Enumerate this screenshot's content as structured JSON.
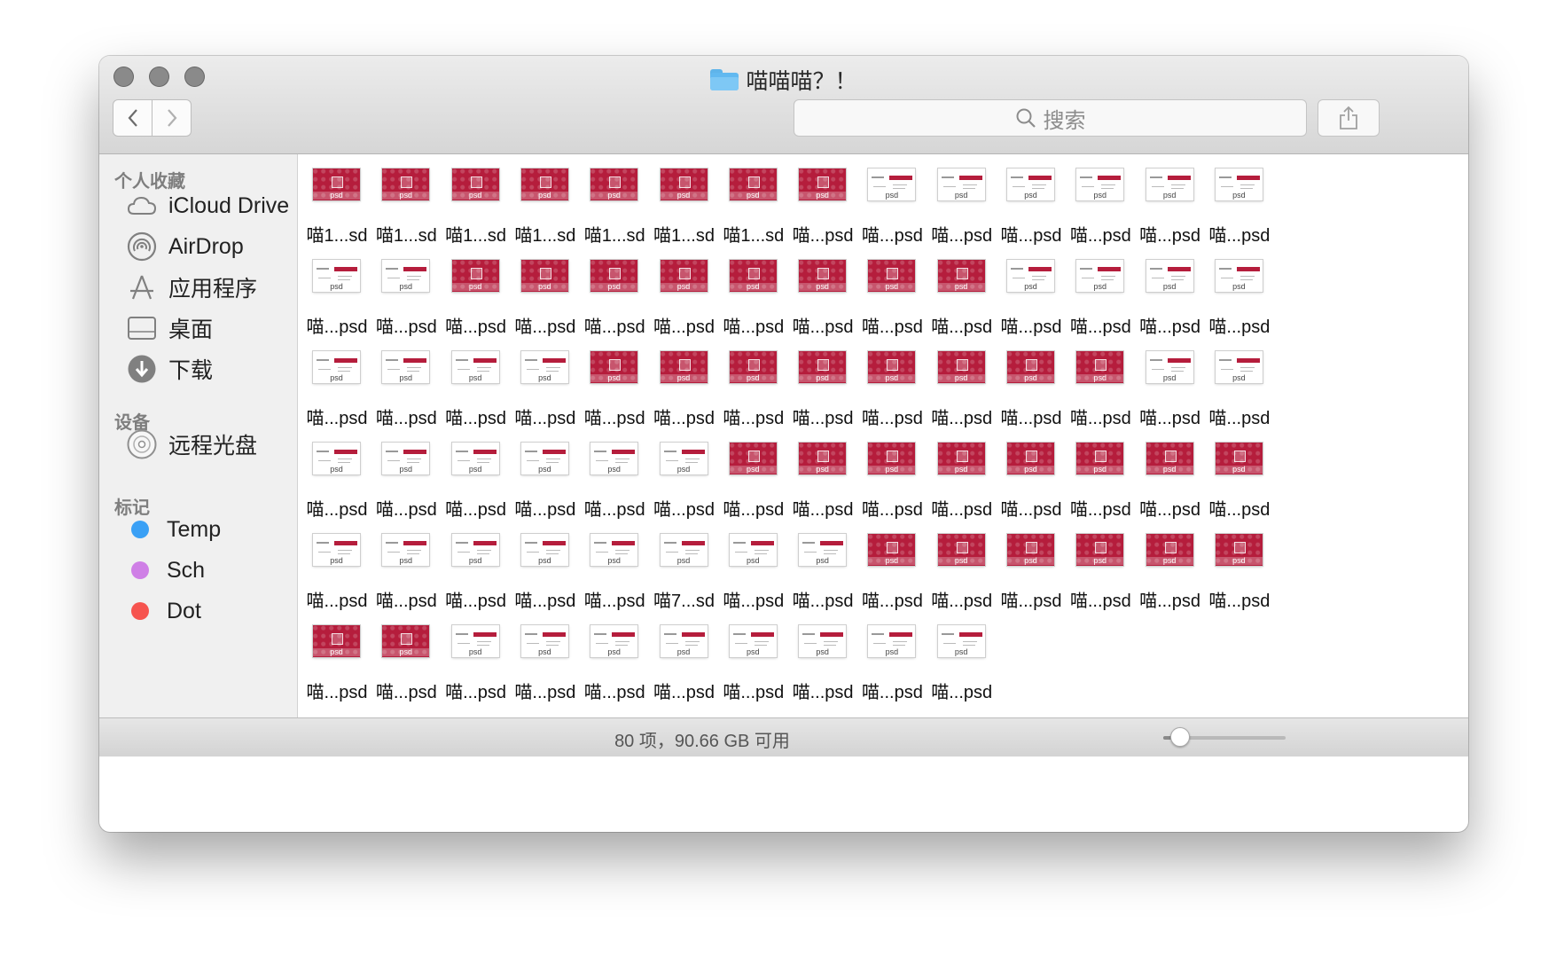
{
  "window": {
    "title": "喵喵喵？！",
    "title_icon": "folder-icon"
  },
  "toolbar": {
    "back_icon": "chevron-left-icon",
    "forward_icon": "chevron-right-icon",
    "search_placeholder": "搜索",
    "share_icon": "share-icon"
  },
  "sidebar": {
    "favorites_title": "个人收藏",
    "favorites": [
      {
        "label": "iCloud Drive",
        "icon": "cloud-icon"
      },
      {
        "label": "AirDrop",
        "icon": "airdrop-icon"
      },
      {
        "label": "应用程序",
        "icon": "applications-icon"
      },
      {
        "label": "桌面",
        "icon": "desktop-icon"
      },
      {
        "label": "下载",
        "icon": "download-icon"
      }
    ],
    "devices_title": "设备",
    "devices": [
      {
        "label": "远程光盘",
        "icon": "disc-icon"
      }
    ],
    "tags_title": "标记",
    "tags": [
      {
        "label": "Temp",
        "color": "#3aa0f5"
      },
      {
        "label": "Sch",
        "color": "#cf7fe6"
      },
      {
        "label": "Dot",
        "color": "#f6544f"
      }
    ]
  },
  "files": [
    {
      "name": "喵1...sd",
      "thumb": "red"
    },
    {
      "name": "喵1...sd",
      "thumb": "red"
    },
    {
      "name": "喵1...sd",
      "thumb": "red"
    },
    {
      "name": "喵1...sd",
      "thumb": "red"
    },
    {
      "name": "喵1...sd",
      "thumb": "red"
    },
    {
      "name": "喵1...sd",
      "thumb": "red"
    },
    {
      "name": "喵1...sd",
      "thumb": "red"
    },
    {
      "name": "喵...psd",
      "thumb": "red"
    },
    {
      "name": "喵...psd",
      "thumb": "white"
    },
    {
      "name": "喵...psd",
      "thumb": "white"
    },
    {
      "name": "喵...psd",
      "thumb": "white"
    },
    {
      "name": "喵...psd",
      "thumb": "white"
    },
    {
      "name": "喵...psd",
      "thumb": "white"
    },
    {
      "name": "喵...psd",
      "thumb": "white"
    },
    {
      "name": "喵...psd",
      "thumb": "white"
    },
    {
      "name": "喵...psd",
      "thumb": "white"
    },
    {
      "name": "喵...psd",
      "thumb": "red"
    },
    {
      "name": "喵...psd",
      "thumb": "red"
    },
    {
      "name": "喵...psd",
      "thumb": "red"
    },
    {
      "name": "喵...psd",
      "thumb": "red"
    },
    {
      "name": "喵...psd",
      "thumb": "red"
    },
    {
      "name": "喵...psd",
      "thumb": "red"
    },
    {
      "name": "喵...psd",
      "thumb": "red"
    },
    {
      "name": "喵...psd",
      "thumb": "red"
    },
    {
      "name": "喵...psd",
      "thumb": "white"
    },
    {
      "name": "喵...psd",
      "thumb": "white"
    },
    {
      "name": "喵...psd",
      "thumb": "white"
    },
    {
      "name": "喵...psd",
      "thumb": "white"
    },
    {
      "name": "喵...psd",
      "thumb": "white"
    },
    {
      "name": "喵...psd",
      "thumb": "white"
    },
    {
      "name": "喵...psd",
      "thumb": "white"
    },
    {
      "name": "喵...psd",
      "thumb": "white"
    },
    {
      "name": "喵...psd",
      "thumb": "red"
    },
    {
      "name": "喵...psd",
      "thumb": "red"
    },
    {
      "name": "喵...psd",
      "thumb": "red"
    },
    {
      "name": "喵...psd",
      "thumb": "red"
    },
    {
      "name": "喵...psd",
      "thumb": "red"
    },
    {
      "name": "喵...psd",
      "thumb": "red"
    },
    {
      "name": "喵...psd",
      "thumb": "red"
    },
    {
      "name": "喵...psd",
      "thumb": "red"
    },
    {
      "name": "喵...psd",
      "thumb": "white"
    },
    {
      "name": "喵...psd",
      "thumb": "white"
    },
    {
      "name": "喵...psd",
      "thumb": "white"
    },
    {
      "name": "喵...psd",
      "thumb": "white"
    },
    {
      "name": "喵...psd",
      "thumb": "white"
    },
    {
      "name": "喵...psd",
      "thumb": "white"
    },
    {
      "name": "喵...psd",
      "thumb": "white"
    },
    {
      "name": "喵...psd",
      "thumb": "white"
    },
    {
      "name": "喵...psd",
      "thumb": "red"
    },
    {
      "name": "喵...psd",
      "thumb": "red"
    },
    {
      "name": "喵...psd",
      "thumb": "red"
    },
    {
      "name": "喵...psd",
      "thumb": "red"
    },
    {
      "name": "喵...psd",
      "thumb": "red"
    },
    {
      "name": "喵...psd",
      "thumb": "red"
    },
    {
      "name": "喵...psd",
      "thumb": "red"
    },
    {
      "name": "喵...psd",
      "thumb": "red"
    },
    {
      "name": "喵...psd",
      "thumb": "white"
    },
    {
      "name": "喵...psd",
      "thumb": "white"
    },
    {
      "name": "喵...psd",
      "thumb": "white"
    },
    {
      "name": "喵...psd",
      "thumb": "white"
    },
    {
      "name": "喵...psd",
      "thumb": "white"
    },
    {
      "name": "喵7...sd",
      "thumb": "white"
    },
    {
      "name": "喵...psd",
      "thumb": "white"
    },
    {
      "name": "喵...psd",
      "thumb": "white"
    },
    {
      "name": "喵...psd",
      "thumb": "red"
    },
    {
      "name": "喵...psd",
      "thumb": "red"
    },
    {
      "name": "喵...psd",
      "thumb": "red"
    },
    {
      "name": "喵...psd",
      "thumb": "red"
    },
    {
      "name": "喵...psd",
      "thumb": "red"
    },
    {
      "name": "喵...psd",
      "thumb": "red"
    },
    {
      "name": "喵...psd",
      "thumb": "red"
    },
    {
      "name": "喵...psd",
      "thumb": "red"
    },
    {
      "name": "喵...psd",
      "thumb": "white"
    },
    {
      "name": "喵...psd",
      "thumb": "white"
    },
    {
      "name": "喵...psd",
      "thumb": "white"
    },
    {
      "name": "喵...psd",
      "thumb": "white"
    },
    {
      "name": "喵...psd",
      "thumb": "white"
    },
    {
      "name": "喵...psd",
      "thumb": "white"
    },
    {
      "name": "喵...psd",
      "thumb": "white"
    },
    {
      "name": "喵...psd",
      "thumb": "white"
    }
  ],
  "thumb_ext": "psd",
  "status": {
    "text": "80 项，90.66 GB 可用",
    "icon_size_level": 0.13
  }
}
